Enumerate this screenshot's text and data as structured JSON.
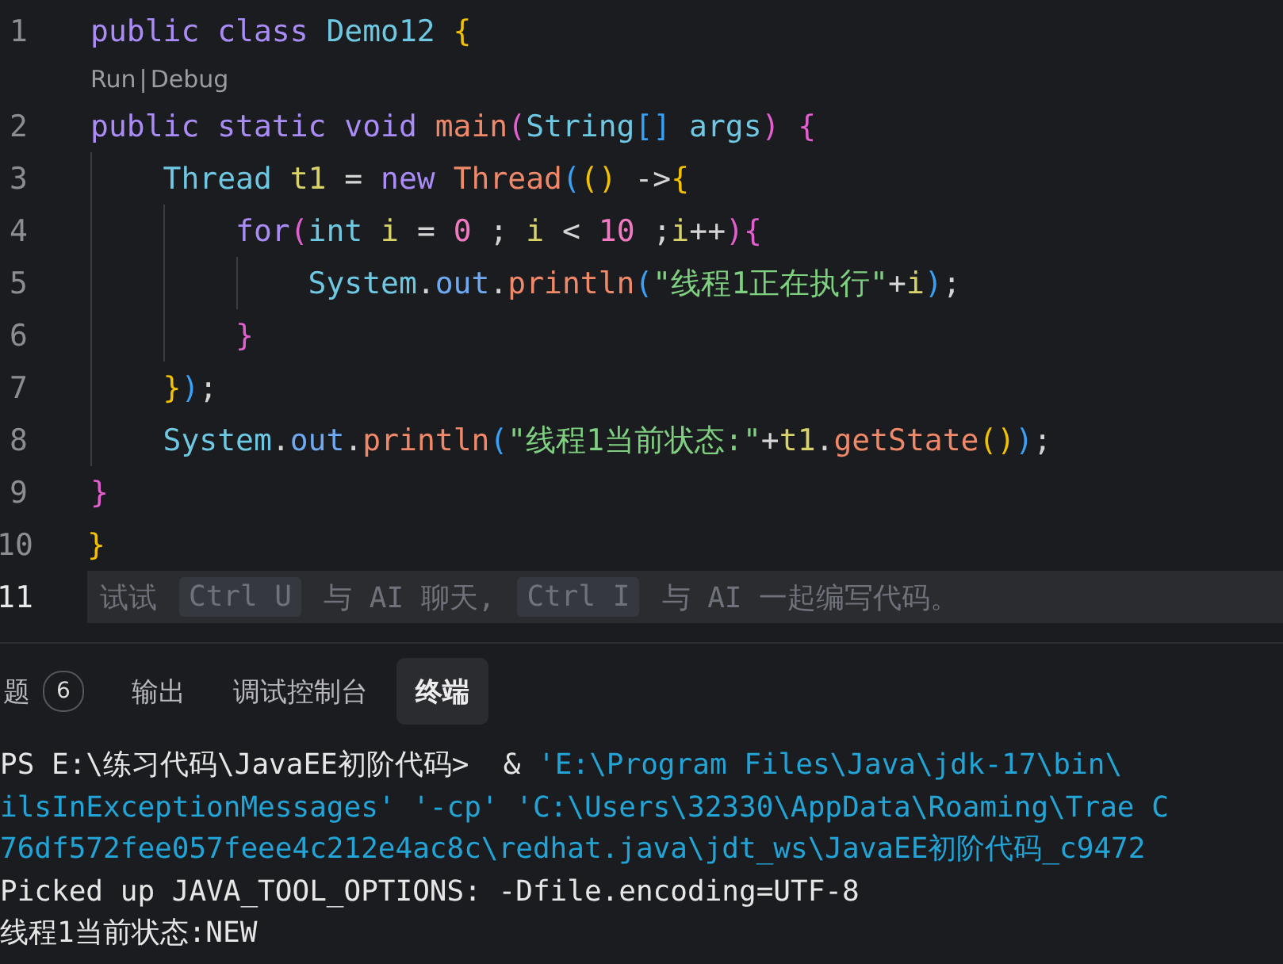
{
  "editor": {
    "lines": [
      {
        "number": "1",
        "current": false,
        "tokens": [
          {
            "kind": "keyword",
            "text": "public class "
          },
          {
            "kind": "type",
            "text": "Demo12 "
          },
          {
            "kind": "brace1",
            "text": "{"
          }
        ]
      },
      {
        "kind": "codelens",
        "links": [
          "Run",
          "Debug"
        ],
        "separator": "|"
      },
      {
        "number": "2",
        "current": false,
        "tokens": [
          {
            "kind": "keyword",
            "text": "public static void "
          },
          {
            "kind": "function",
            "text": "main"
          },
          {
            "kind": "brace2",
            "text": "("
          },
          {
            "kind": "type",
            "text": "String"
          },
          {
            "kind": "brace3",
            "text": "[]"
          },
          {
            "kind": "type",
            "text": " args"
          },
          {
            "kind": "brace2",
            "text": ") {"
          }
        ]
      },
      {
        "number": "3",
        "current": false,
        "tokens": [
          {
            "kind": "indent"
          },
          {
            "kind": "type",
            "text": "Thread "
          },
          {
            "kind": "variable",
            "text": "t1"
          },
          {
            "kind": "plain",
            "text": " = "
          },
          {
            "kind": "keyword",
            "text": "new "
          },
          {
            "kind": "function",
            "text": "Thread"
          },
          {
            "kind": "brace3",
            "text": "("
          },
          {
            "kind": "brace1",
            "text": "()"
          },
          {
            "kind": "plain",
            "text": " ->"
          },
          {
            "kind": "brace1",
            "text": "{"
          }
        ]
      },
      {
        "number": "4",
        "current": false,
        "tokens": [
          {
            "kind": "indent"
          },
          {
            "kind": "indent"
          },
          {
            "kind": "keyword",
            "text": "for"
          },
          {
            "kind": "brace2",
            "text": "("
          },
          {
            "kind": "type",
            "text": "int "
          },
          {
            "kind": "variable",
            "text": "i"
          },
          {
            "kind": "plain",
            "text": " = "
          },
          {
            "kind": "number",
            "text": "0"
          },
          {
            "kind": "plain",
            "text": " ; "
          },
          {
            "kind": "variable",
            "text": "i"
          },
          {
            "kind": "plain",
            "text": " < "
          },
          {
            "kind": "number",
            "text": "10"
          },
          {
            "kind": "plain",
            "text": " ;"
          },
          {
            "kind": "variable",
            "text": "i"
          },
          {
            "kind": "plain",
            "text": "++"
          },
          {
            "kind": "brace2",
            "text": "){"
          }
        ]
      },
      {
        "number": "5",
        "current": false,
        "tokens": [
          {
            "kind": "indent"
          },
          {
            "kind": "indent"
          },
          {
            "kind": "indent"
          },
          {
            "kind": "type",
            "text": "System"
          },
          {
            "kind": "plain",
            "text": "."
          },
          {
            "kind": "field",
            "text": "out"
          },
          {
            "kind": "plain",
            "text": "."
          },
          {
            "kind": "function",
            "text": "println"
          },
          {
            "kind": "brace3",
            "text": "("
          },
          {
            "kind": "string",
            "text": "\"线程1正在执行\""
          },
          {
            "kind": "plain",
            "text": "+"
          },
          {
            "kind": "variable",
            "text": "i"
          },
          {
            "kind": "brace3",
            "text": ")"
          },
          {
            "kind": "plain",
            "text": ";"
          }
        ]
      },
      {
        "number": "6",
        "current": false,
        "tokens": [
          {
            "kind": "indent"
          },
          {
            "kind": "indent"
          },
          {
            "kind": "brace2",
            "text": "}"
          }
        ]
      },
      {
        "number": "7",
        "current": false,
        "tokens": [
          {
            "kind": "indent"
          },
          {
            "kind": "brace1",
            "text": "}"
          },
          {
            "kind": "brace3",
            "text": ")"
          },
          {
            "kind": "plain",
            "text": ";"
          }
        ]
      },
      {
        "number": "8",
        "current": false,
        "tokens": [
          {
            "kind": "indent"
          },
          {
            "kind": "type",
            "text": "System"
          },
          {
            "kind": "plain",
            "text": "."
          },
          {
            "kind": "field",
            "text": "out"
          },
          {
            "kind": "plain",
            "text": "."
          },
          {
            "kind": "function",
            "text": "println"
          },
          {
            "kind": "brace3",
            "text": "("
          },
          {
            "kind": "string",
            "text": "\"线程1当前状态:\""
          },
          {
            "kind": "plain",
            "text": "+"
          },
          {
            "kind": "variable",
            "text": "t1"
          },
          {
            "kind": "plain",
            "text": "."
          },
          {
            "kind": "function",
            "text": "getState"
          },
          {
            "kind": "brace1",
            "text": "()"
          },
          {
            "kind": "brace3",
            "text": ")"
          },
          {
            "kind": "plain",
            "text": ";"
          }
        ]
      },
      {
        "number": "9",
        "current": false,
        "tokens": [
          {
            "kind": "brace2",
            "text": "}"
          }
        ]
      },
      {
        "number": "10",
        "current": false,
        "tokens": [
          {
            "kind": "brace1",
            "text": "}"
          }
        ]
      },
      {
        "number": "11",
        "current": true,
        "hint": [
          {
            "kind": "text",
            "text": "试试"
          },
          {
            "kind": "key",
            "text": "Ctrl U"
          },
          {
            "kind": "text",
            "text": "与 AI 聊天,"
          },
          {
            "kind": "key",
            "text": "Ctrl I"
          },
          {
            "kind": "text",
            "text": "与 AI 一起编写代码。"
          }
        ]
      }
    ]
  },
  "panel": {
    "tabs": [
      {
        "label": "题",
        "badge": "6",
        "selected": false
      },
      {
        "label": "输出",
        "selected": false
      },
      {
        "label": "调试控制台",
        "selected": false
      },
      {
        "label": "终端",
        "selected": true
      }
    ],
    "terminal": [
      [
        {
          "kind": "plain",
          "text": "PS E:\\练习代码\\JavaEE初阶代码>  & "
        },
        {
          "kind": "path",
          "text": "'E:\\Program Files\\Java\\jdk-17\\bin\\"
        }
      ],
      [
        {
          "kind": "path",
          "text": "ilsInExceptionMessages' '-cp' 'C:\\Users\\32330\\AppData\\Roaming\\Trae C"
        }
      ],
      [
        {
          "kind": "path",
          "text": "76df572fee057feee4c212e4ac8c\\redhat.java\\jdt_ws\\JavaEE初阶代码_c9472"
        }
      ],
      [
        {
          "kind": "plain",
          "text": "Picked up JAVA_TOOL_OPTIONS: -Dfile.encoding=UTF-8"
        }
      ],
      [
        {
          "kind": "plain",
          "text": "线程1当前状态:NEW"
        }
      ]
    ]
  }
}
